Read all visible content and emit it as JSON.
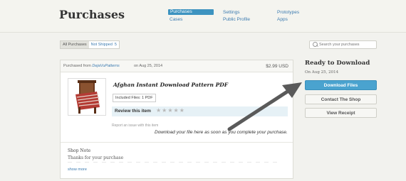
{
  "header": {
    "title": "Purchases",
    "nav": {
      "purchases": "Purchases",
      "cases": "Cases",
      "settings": "Settings",
      "public_profile": "Public Profile",
      "prototypes": "Prototypes",
      "apps": "Apps"
    }
  },
  "filters": {
    "all": "All Purchases",
    "not_shipped": "Not Shipped",
    "not_shipped_count": "5"
  },
  "search": {
    "placeholder": "Search your purchases"
  },
  "purchase": {
    "purchased_from_label": "Purchased from",
    "shop_name": "DejaVuPatterns",
    "date": "on Aug 25, 2014",
    "price": "$2.99 USD",
    "title": "Afghan Instant Download Pattern PDF",
    "included_files": "Included Files: 1 PDF",
    "review_label": "Review this item",
    "stars": "★★★★★",
    "report_issue": "Report an issue with this item",
    "annotation": "Download your file here as soon as you complete your purchase.",
    "shop_note_title": "Shop Note",
    "shop_note_text": "Thanks for your purchase",
    "show_more": "show more"
  },
  "sidebar": {
    "ready_title": "Ready to Download",
    "ready_date": "On Aug 25, 2014",
    "download_button": "Download Files",
    "contact_button": "Contact The Shop",
    "receipt_button": "View Receipt"
  },
  "colors": {
    "accent": "#4aa3cf",
    "link": "#3c7bb0",
    "arrow": "#5a5a5a"
  }
}
